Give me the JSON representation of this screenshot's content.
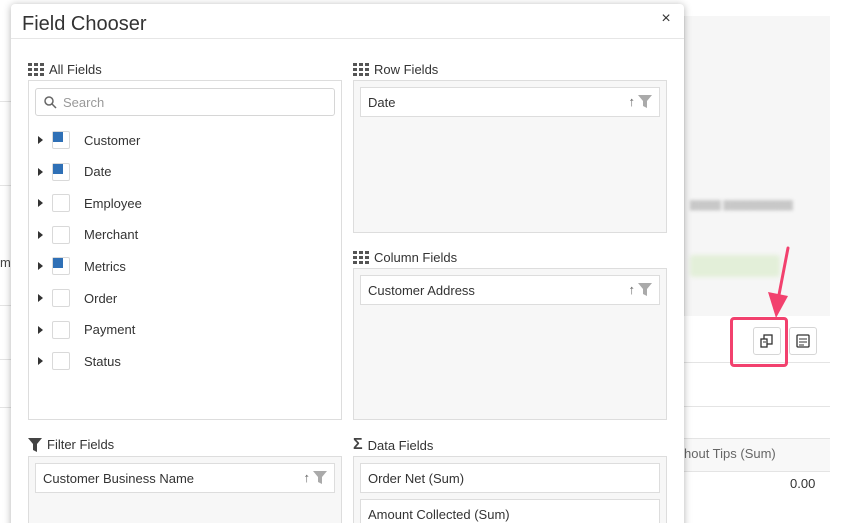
{
  "background": {
    "left_cutoff_text": "mi",
    "right_column_header": "hout Tips (Sum)",
    "right_column_value": "0.00"
  },
  "dialog": {
    "title": "Field Chooser",
    "close_label": "×"
  },
  "all_fields": {
    "label": "All Fields",
    "search_placeholder": "Search",
    "items": [
      {
        "label": "Customer",
        "state": "partial"
      },
      {
        "label": "Date",
        "state": "partial"
      },
      {
        "label": "Employee",
        "state": "unchecked"
      },
      {
        "label": "Merchant",
        "state": "unchecked"
      },
      {
        "label": "Metrics",
        "state": "partial"
      },
      {
        "label": "Order",
        "state": "unchecked"
      },
      {
        "label": "Payment",
        "state": "unchecked"
      },
      {
        "label": "Status",
        "state": "unchecked"
      }
    ]
  },
  "row_fields": {
    "label": "Row Fields",
    "items": [
      "Date"
    ]
  },
  "column_fields": {
    "label": "Column Fields",
    "items": [
      "Customer Address"
    ]
  },
  "filter_fields": {
    "label": "Filter Fields",
    "items": [
      "Customer Business Name"
    ]
  },
  "data_fields": {
    "label": "Data Fields",
    "items": [
      "Order Net (Sum)",
      "Amount Collected (Sum)"
    ]
  },
  "colors": {
    "accent_blue": "#2f70b6",
    "highlight_pink": "#f2416e"
  },
  "icons": {
    "sort": "sort-up-icon",
    "filter": "filter-icon",
    "grid": "grid-icon",
    "sigma": "sigma-icon",
    "search": "search-icon",
    "field_chooser": "field-chooser-icon",
    "export": "export-icon"
  }
}
